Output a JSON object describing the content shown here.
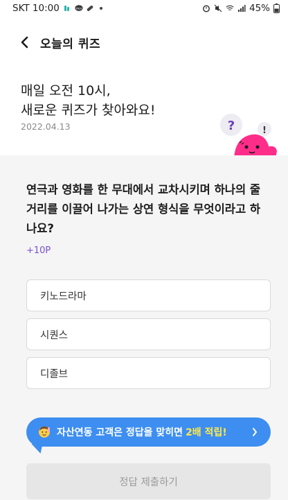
{
  "status_bar": {
    "carrier_time": "SKT 10:00",
    "notification_icons": [
      "tape-icon",
      "talk-icon",
      "pill-icon",
      "dot-icon"
    ],
    "system_icons": [
      "alarm-icon",
      "mute-icon",
      "wifi-icon",
      "signal-icon"
    ],
    "battery": "45%"
  },
  "header": {
    "title": "오늘의 퀴즈"
  },
  "hero": {
    "title": "매일 오전 10시,\n새로운 퀴즈가 찾아와요!",
    "date": "2022.04.13",
    "mascot": {
      "question_mark": "?",
      "exclamation_mark": "!"
    }
  },
  "quiz": {
    "question": "연극과 영화를 한 무대에서 교차시키며 하나의 줄거리를 이끌어 나가는 상연 형식을 무엇이라고 하나요?",
    "points": "+10P",
    "options": [
      "키노드라마",
      "시퀀스",
      "디졸브"
    ]
  },
  "promo": {
    "text": "자산연동 고객은 정답을 맞히면",
    "highlight": "2배 적립!",
    "accent_color": "#3d8ef0",
    "highlight_color": "#ffe94a"
  },
  "submit": {
    "label": "정답 제출하기"
  },
  "colors": {
    "points": "#7b4fd6",
    "mascot": "#ff2d8a",
    "quiz_bg": "#f5f5f5"
  }
}
